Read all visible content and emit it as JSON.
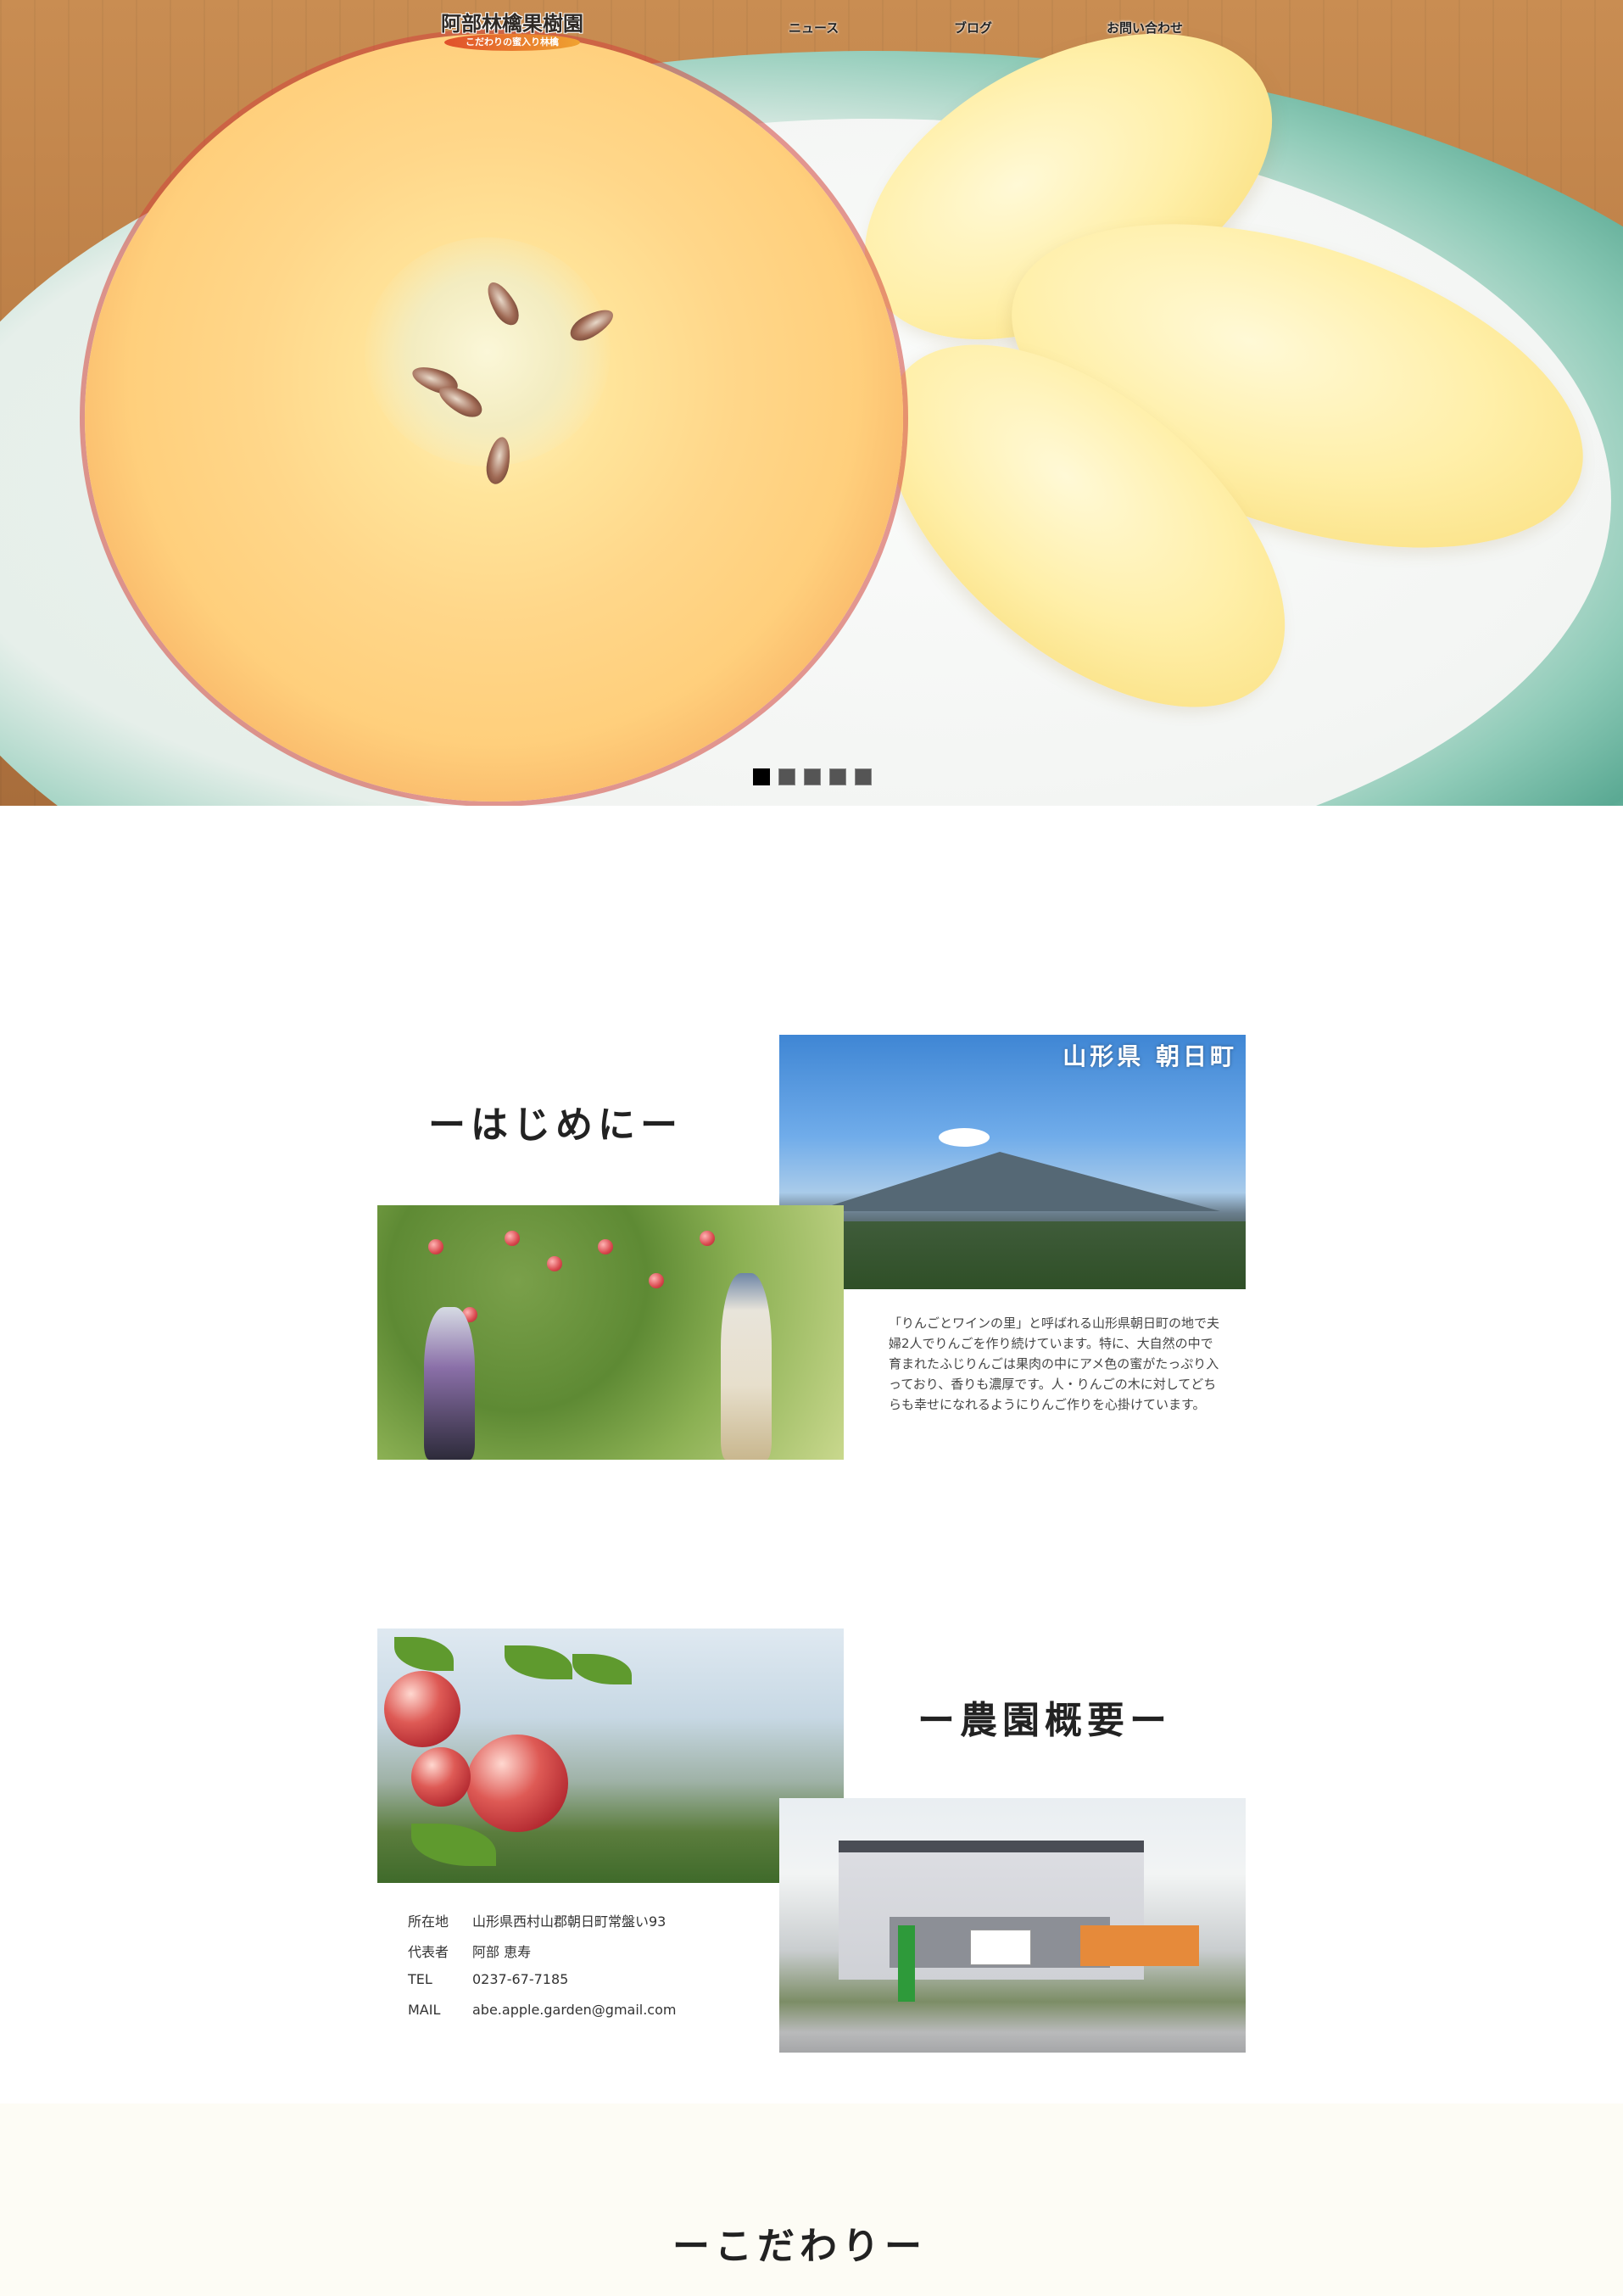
{
  "header": {
    "logo_title": "阿部林檎果樹園",
    "logo_subtitle": "こだわりの蜜入り林檎",
    "nav": [
      {
        "label": "ニュース"
      },
      {
        "label": "ブログ"
      },
      {
        "label": "お問い合わせ"
      }
    ]
  },
  "slider": {
    "dots": [
      {
        "label": "slide 1",
        "active": true
      },
      {
        "label": "slide 2",
        "active": false
      },
      {
        "label": "slide 3",
        "active": false
      },
      {
        "label": "slide 4",
        "active": false
      },
      {
        "label": "slide 5",
        "active": false
      }
    ]
  },
  "intro": {
    "heading": "ーはじめにー",
    "photo_caption": "山形県 朝日町",
    "text": "「りんごとワインの里」と呼ばれる山形県朝日町の地で夫婦2人でりんごを作り続けています。特に、大自然の中で育まれたふじりんごは果肉の中にアメ色の蜜がたっぷり入っており、香りも濃厚です。人・りんごの木に対してどちらも幸せになれるようにりんご作りを心掛けています。"
  },
  "farm": {
    "heading": "ー農園概要ー",
    "info": [
      {
        "label": "所在地",
        "value": "山形県西村山郡朝日町常盤い93"
      },
      {
        "label": "代表者",
        "value": "阿部 恵寿"
      },
      {
        "label": "TEL",
        "value": "0237-67-7185"
      },
      {
        "label": "MAIL",
        "value": "abe.apple.garden@gmail.com"
      }
    ]
  },
  "commitment": {
    "heading": "ーこだわりー"
  },
  "colors": {
    "accent": "#e0502b",
    "text": "#222222",
    "background_cream": "#fdfcf5"
  }
}
